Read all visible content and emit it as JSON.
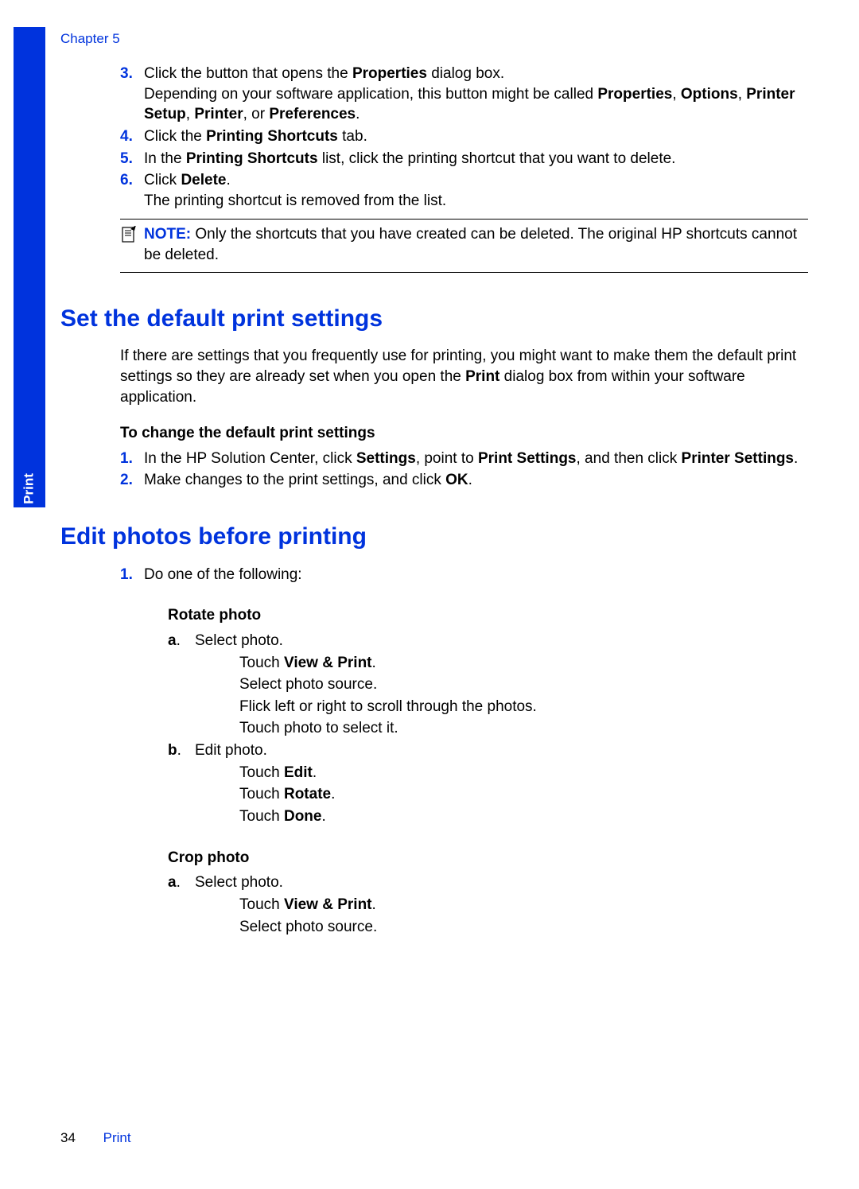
{
  "meta": {
    "chapter_label": "Chapter 5",
    "tab_label": "Print",
    "page_number": "34",
    "footer_title": "Print"
  },
  "section_a": {
    "step3_num": "3.",
    "step3_a": "Click the button that opens the ",
    "step3_b": "Properties",
    "step3_c": " dialog box.",
    "step3_d": "Depending on your software application, this button might be called ",
    "step3_e": "Properties",
    "step3_f": ", ",
    "step3_g": "Options",
    "step3_h": ", ",
    "step3_i": "Printer Setup",
    "step3_j": ", ",
    "step3_k": "Printer",
    "step3_l": ", or ",
    "step3_m": "Preferences",
    "step3_n": ".",
    "step4_num": "4.",
    "step4_a": "Click the ",
    "step4_b": "Printing Shortcuts",
    "step4_c": " tab.",
    "step5_num": "5.",
    "step5_a": "In the ",
    "step5_b": "Printing Shortcuts",
    "step5_c": " list, click the printing shortcut that you want to delete.",
    "step6_num": "6.",
    "step6_a": "Click ",
    "step6_b": "Delete",
    "step6_c": ".",
    "step6_d": "The printing shortcut is removed from the list.",
    "note_label": "NOTE:",
    "note_text": "Only the shortcuts that you have created can be deleted. The original HP shortcuts cannot be deleted."
  },
  "section_b": {
    "heading": "Set the default print settings",
    "intro_a": "If there are settings that you frequently use for printing, you might want to make them the default print settings so they are already set when you open the ",
    "intro_b": "Print",
    "intro_c": " dialog box from within your software application.",
    "subheading": "To change the default print settings",
    "s1_num": "1.",
    "s1_a": "In the HP Solution Center, click ",
    "s1_b": "Settings",
    "s1_c": ", point to ",
    "s1_d": "Print Settings",
    "s1_e": ", and then click ",
    "s1_f": "Printer Settings",
    "s1_g": ".",
    "s2_num": "2.",
    "s2_a": "Make changes to the print settings, and click ",
    "s2_b": "OK",
    "s2_c": "."
  },
  "section_c": {
    "heading": "Edit photos before printing",
    "s1_num": "1.",
    "s1_text": "Do one of the following:",
    "rotate_heading": "Rotate photo",
    "ra_letter": "a",
    "ra_dot": ".",
    "ra_text": "Select photo.",
    "ra_l1_a": "Touch ",
    "ra_l1_b": "View & Print",
    "ra_l1_c": ".",
    "ra_l2": "Select photo source.",
    "ra_l3": "Flick left or right to scroll through the photos.",
    "ra_l4": "Touch photo to select it.",
    "rb_letter": "b",
    "rb_dot": ".",
    "rb_text": "Edit photo.",
    "rb_l1_a": "Touch ",
    "rb_l1_b": "Edit",
    "rb_l1_c": ".",
    "rb_l2_a": "Touch ",
    "rb_l2_b": "Rotate",
    "rb_l2_c": ".",
    "rb_l3_a": "Touch ",
    "rb_l3_b": "Done",
    "rb_l3_c": ".",
    "crop_heading": "Crop photo",
    "ca_letter": "a",
    "ca_dot": ".",
    "ca_text": "Select photo.",
    "ca_l1_a": "Touch ",
    "ca_l1_b": "View & Print",
    "ca_l1_c": ".",
    "ca_l2": "Select photo source."
  }
}
